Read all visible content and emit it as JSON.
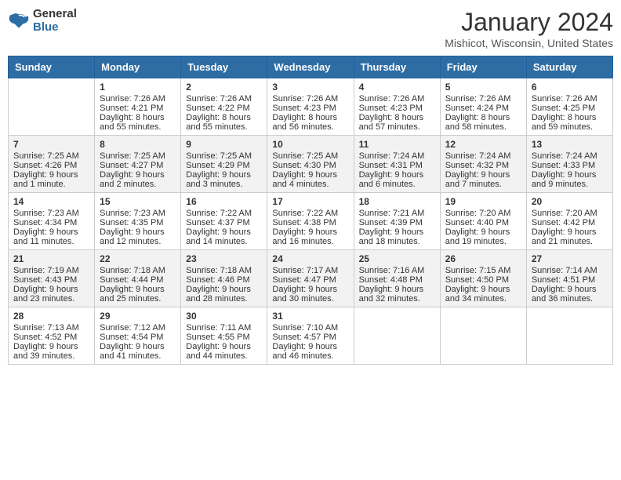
{
  "header": {
    "logo_general": "General",
    "logo_blue": "Blue",
    "month_title": "January 2024",
    "location": "Mishicot, Wisconsin, United States"
  },
  "weekdays": [
    "Sunday",
    "Monday",
    "Tuesday",
    "Wednesday",
    "Thursday",
    "Friday",
    "Saturday"
  ],
  "weeks": [
    [
      {
        "day": "",
        "sunrise": "",
        "sunset": "",
        "daylight": ""
      },
      {
        "day": "1",
        "sunrise": "Sunrise: 7:26 AM",
        "sunset": "Sunset: 4:21 PM",
        "daylight": "Daylight: 8 hours and 55 minutes."
      },
      {
        "day": "2",
        "sunrise": "Sunrise: 7:26 AM",
        "sunset": "Sunset: 4:22 PM",
        "daylight": "Daylight: 8 hours and 55 minutes."
      },
      {
        "day": "3",
        "sunrise": "Sunrise: 7:26 AM",
        "sunset": "Sunset: 4:23 PM",
        "daylight": "Daylight: 8 hours and 56 minutes."
      },
      {
        "day": "4",
        "sunrise": "Sunrise: 7:26 AM",
        "sunset": "Sunset: 4:23 PM",
        "daylight": "Daylight: 8 hours and 57 minutes."
      },
      {
        "day": "5",
        "sunrise": "Sunrise: 7:26 AM",
        "sunset": "Sunset: 4:24 PM",
        "daylight": "Daylight: 8 hours and 58 minutes."
      },
      {
        "day": "6",
        "sunrise": "Sunrise: 7:26 AM",
        "sunset": "Sunset: 4:25 PM",
        "daylight": "Daylight: 8 hours and 59 minutes."
      }
    ],
    [
      {
        "day": "7",
        "sunrise": "Sunrise: 7:25 AM",
        "sunset": "Sunset: 4:26 PM",
        "daylight": "Daylight: 9 hours and 1 minute."
      },
      {
        "day": "8",
        "sunrise": "Sunrise: 7:25 AM",
        "sunset": "Sunset: 4:27 PM",
        "daylight": "Daylight: 9 hours and 2 minutes."
      },
      {
        "day": "9",
        "sunrise": "Sunrise: 7:25 AM",
        "sunset": "Sunset: 4:29 PM",
        "daylight": "Daylight: 9 hours and 3 minutes."
      },
      {
        "day": "10",
        "sunrise": "Sunrise: 7:25 AM",
        "sunset": "Sunset: 4:30 PM",
        "daylight": "Daylight: 9 hours and 4 minutes."
      },
      {
        "day": "11",
        "sunrise": "Sunrise: 7:24 AM",
        "sunset": "Sunset: 4:31 PM",
        "daylight": "Daylight: 9 hours and 6 minutes."
      },
      {
        "day": "12",
        "sunrise": "Sunrise: 7:24 AM",
        "sunset": "Sunset: 4:32 PM",
        "daylight": "Daylight: 9 hours and 7 minutes."
      },
      {
        "day": "13",
        "sunrise": "Sunrise: 7:24 AM",
        "sunset": "Sunset: 4:33 PM",
        "daylight": "Daylight: 9 hours and 9 minutes."
      }
    ],
    [
      {
        "day": "14",
        "sunrise": "Sunrise: 7:23 AM",
        "sunset": "Sunset: 4:34 PM",
        "daylight": "Daylight: 9 hours and 11 minutes."
      },
      {
        "day": "15",
        "sunrise": "Sunrise: 7:23 AM",
        "sunset": "Sunset: 4:35 PM",
        "daylight": "Daylight: 9 hours and 12 minutes."
      },
      {
        "day": "16",
        "sunrise": "Sunrise: 7:22 AM",
        "sunset": "Sunset: 4:37 PM",
        "daylight": "Daylight: 9 hours and 14 minutes."
      },
      {
        "day": "17",
        "sunrise": "Sunrise: 7:22 AM",
        "sunset": "Sunset: 4:38 PM",
        "daylight": "Daylight: 9 hours and 16 minutes."
      },
      {
        "day": "18",
        "sunrise": "Sunrise: 7:21 AM",
        "sunset": "Sunset: 4:39 PM",
        "daylight": "Daylight: 9 hours and 18 minutes."
      },
      {
        "day": "19",
        "sunrise": "Sunrise: 7:20 AM",
        "sunset": "Sunset: 4:40 PM",
        "daylight": "Daylight: 9 hours and 19 minutes."
      },
      {
        "day": "20",
        "sunrise": "Sunrise: 7:20 AM",
        "sunset": "Sunset: 4:42 PM",
        "daylight": "Daylight: 9 hours and 21 minutes."
      }
    ],
    [
      {
        "day": "21",
        "sunrise": "Sunrise: 7:19 AM",
        "sunset": "Sunset: 4:43 PM",
        "daylight": "Daylight: 9 hours and 23 minutes."
      },
      {
        "day": "22",
        "sunrise": "Sunrise: 7:18 AM",
        "sunset": "Sunset: 4:44 PM",
        "daylight": "Daylight: 9 hours and 25 minutes."
      },
      {
        "day": "23",
        "sunrise": "Sunrise: 7:18 AM",
        "sunset": "Sunset: 4:46 PM",
        "daylight": "Daylight: 9 hours and 28 minutes."
      },
      {
        "day": "24",
        "sunrise": "Sunrise: 7:17 AM",
        "sunset": "Sunset: 4:47 PM",
        "daylight": "Daylight: 9 hours and 30 minutes."
      },
      {
        "day": "25",
        "sunrise": "Sunrise: 7:16 AM",
        "sunset": "Sunset: 4:48 PM",
        "daylight": "Daylight: 9 hours and 32 minutes."
      },
      {
        "day": "26",
        "sunrise": "Sunrise: 7:15 AM",
        "sunset": "Sunset: 4:50 PM",
        "daylight": "Daylight: 9 hours and 34 minutes."
      },
      {
        "day": "27",
        "sunrise": "Sunrise: 7:14 AM",
        "sunset": "Sunset: 4:51 PM",
        "daylight": "Daylight: 9 hours and 36 minutes."
      }
    ],
    [
      {
        "day": "28",
        "sunrise": "Sunrise: 7:13 AM",
        "sunset": "Sunset: 4:52 PM",
        "daylight": "Daylight: 9 hours and 39 minutes."
      },
      {
        "day": "29",
        "sunrise": "Sunrise: 7:12 AM",
        "sunset": "Sunset: 4:54 PM",
        "daylight": "Daylight: 9 hours and 41 minutes."
      },
      {
        "day": "30",
        "sunrise": "Sunrise: 7:11 AM",
        "sunset": "Sunset: 4:55 PM",
        "daylight": "Daylight: 9 hours and 44 minutes."
      },
      {
        "day": "31",
        "sunrise": "Sunrise: 7:10 AM",
        "sunset": "Sunset: 4:57 PM",
        "daylight": "Daylight: 9 hours and 46 minutes."
      },
      {
        "day": "",
        "sunrise": "",
        "sunset": "",
        "daylight": ""
      },
      {
        "day": "",
        "sunrise": "",
        "sunset": "",
        "daylight": ""
      },
      {
        "day": "",
        "sunrise": "",
        "sunset": "",
        "daylight": ""
      }
    ]
  ]
}
